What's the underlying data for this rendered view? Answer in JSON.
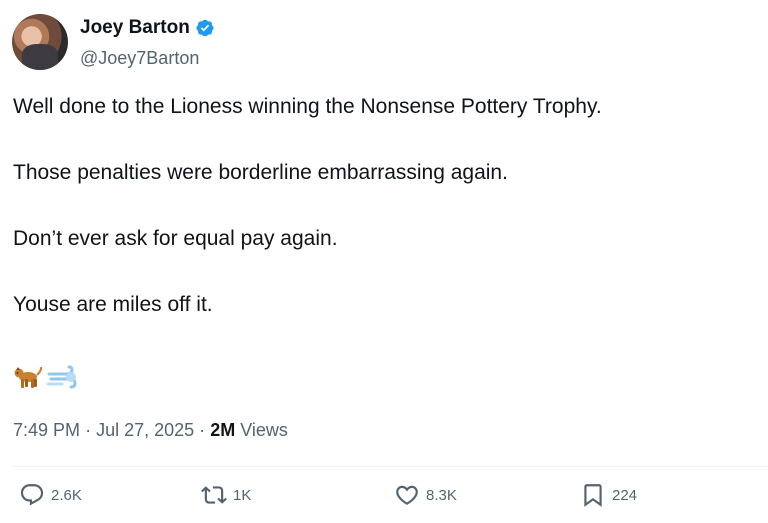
{
  "author": {
    "display_name": "Joey Barton",
    "handle": "@Joey7Barton"
  },
  "tweet": {
    "paragraphs": [
      "Well done to the Lioness winning the Nonsense Pottery Trophy.",
      "Those penalties were borderline embarrassing again.",
      "Don’t ever ask for equal pay again.",
      "Youse are miles off it."
    ],
    "emojis": [
      "dog-icon",
      "dash-icon"
    ]
  },
  "meta": {
    "time": "7:49 PM",
    "date": "Jul 27, 2025",
    "separator": "·",
    "views_count": "2M",
    "views_label": "Views"
  },
  "actions": {
    "replies": "2.6K",
    "reposts": "1K",
    "likes": "8.3K",
    "bookmarks": "224"
  },
  "colors": {
    "verified": "#1d9bf0",
    "secondary_text": "#536471",
    "primary_text": "#0f1419"
  }
}
